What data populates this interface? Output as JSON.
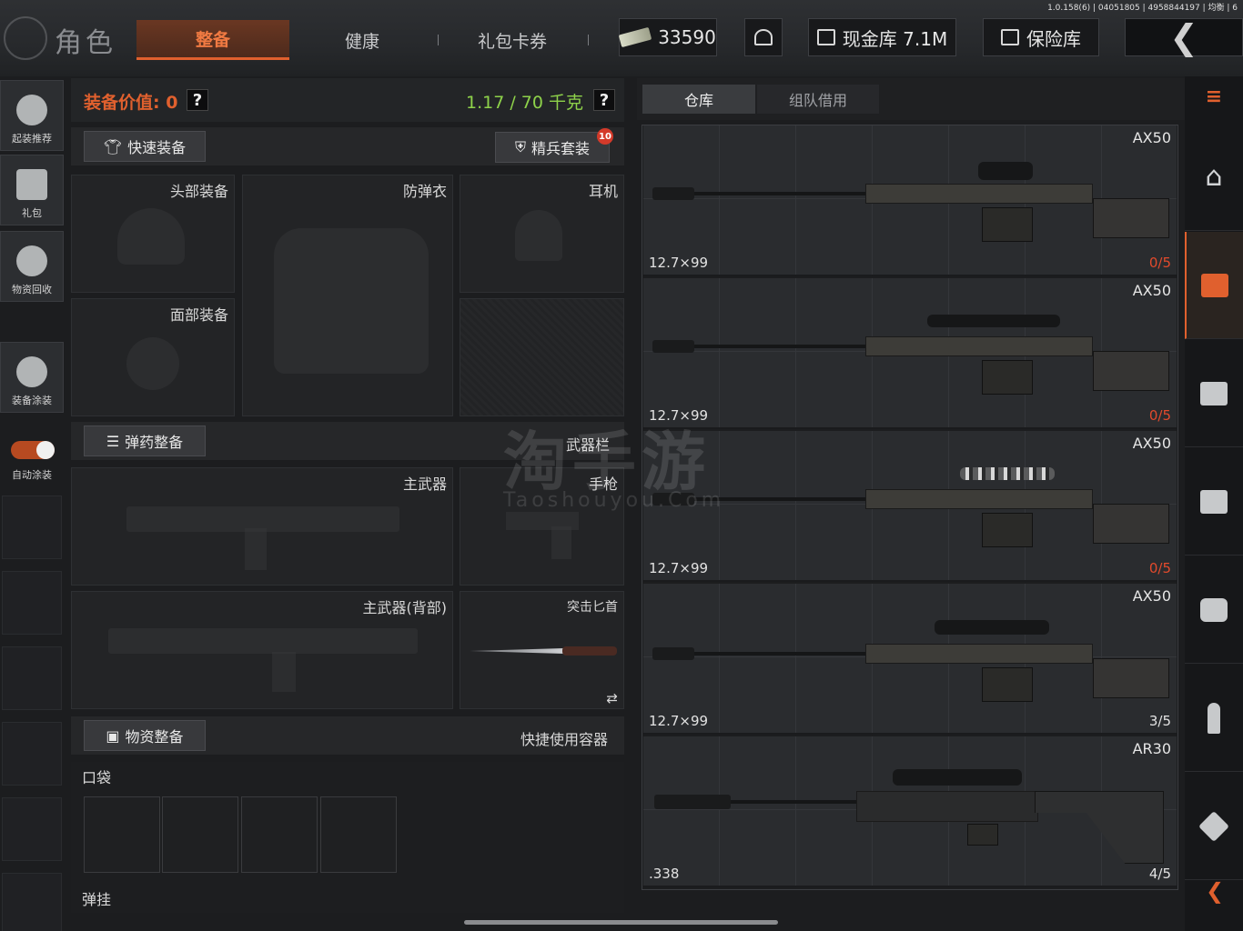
{
  "version": "1.0.158(6) | 04051805 | 4958844197 | 均衡 | 6",
  "header": {
    "title": "角色",
    "tabs": [
      "整备",
      "健康",
      "礼包卡券"
    ],
    "cash": "33590",
    "vault_cash": "现金库 7.1M",
    "safe": "保险库",
    "back_icon": "chevron-left-icon"
  },
  "left_nav": {
    "items": [
      {
        "label": "起装推荐",
        "icon": "loadout-icon"
      },
      {
        "label": "礼包",
        "icon": "gift-icon"
      },
      {
        "label": "物资回收",
        "icon": "recycle-icon"
      },
      {
        "label": "装备涂装",
        "icon": "paint-icon"
      }
    ],
    "auto_paint": {
      "label": "自动涂装",
      "enabled": true
    }
  },
  "equipment": {
    "value_label": "装备价值: 0",
    "weight": "1.17 / 70 千克",
    "help": "?",
    "quick_equip": "快速装备",
    "elite_set": "精兵套装",
    "elite_badge": "10",
    "slots": {
      "head": "头部装备",
      "armor": "防弹衣",
      "ear": "耳机",
      "face": "面部装备"
    },
    "ammo_btn": "弹药整备",
    "weapon_bar": "武器栏",
    "weapon_slots": {
      "primary": "主武器",
      "pistol": "手枪",
      "primary_back": "主武器(背部)",
      "dagger": "突击匕首"
    },
    "supplies_btn": "物资整备",
    "quick_container": "快捷使用容器",
    "pocket": "口袋",
    "ammo_rig": "弹挂"
  },
  "warehouse": {
    "tabs": [
      "仓库",
      "组队借用"
    ],
    "items": [
      {
        "name": "AX50",
        "caliber": "12.7×99",
        "durability": "0/5",
        "broken": true
      },
      {
        "name": "AX50",
        "caliber": "12.7×99",
        "durability": "0/5",
        "broken": true
      },
      {
        "name": "AX50",
        "caliber": "12.7×99",
        "durability": "0/5",
        "broken": true
      },
      {
        "name": "AX50",
        "caliber": "12.7×99",
        "durability": "3/5",
        "broken": false
      },
      {
        "name": "AR30",
        "caliber": ".338",
        "durability": "4/5",
        "broken": false
      }
    ]
  },
  "right_nav": [
    "filter-icon",
    "home-icon",
    "warehouse-icon",
    "box-icon",
    "box-icon",
    "medkit-icon",
    "ammo-icon",
    "cube-icon",
    "collapse-icon"
  ],
  "watermark": {
    "main": "淘手游",
    "sub": "Taoshouyou.Com"
  },
  "colors": {
    "accent": "#e0602e",
    "weight": "#8ed24a",
    "broken": "#e24a2c"
  }
}
